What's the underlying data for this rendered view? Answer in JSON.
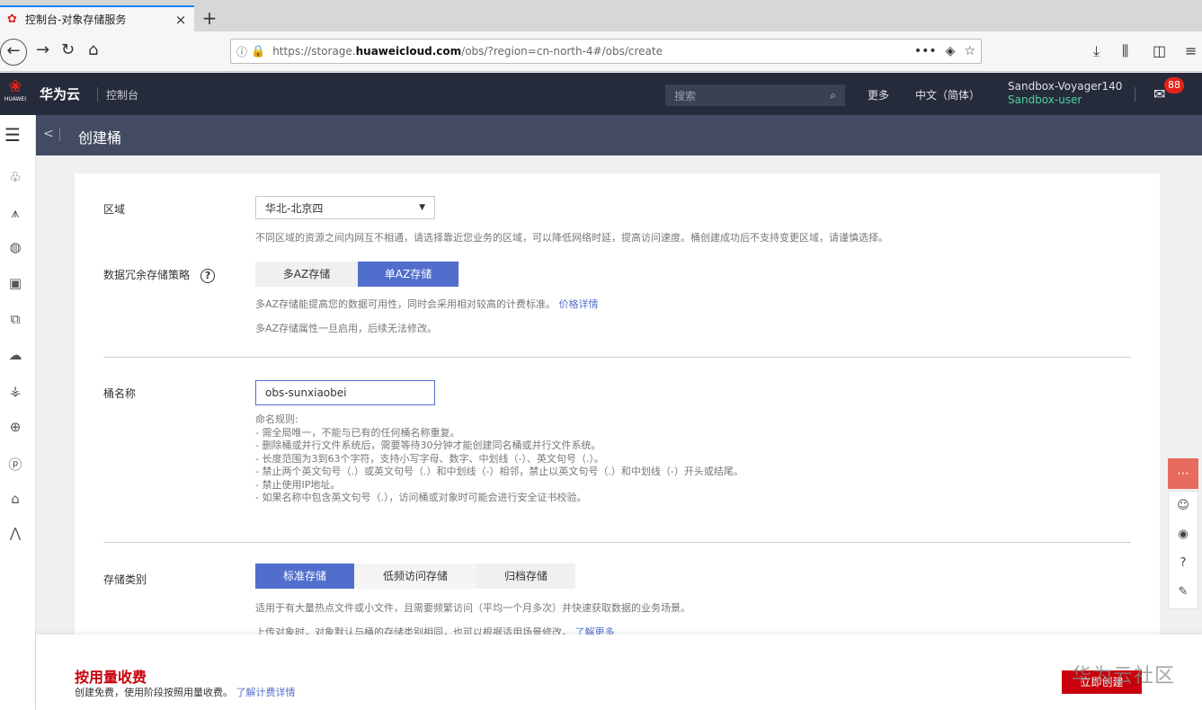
{
  "browser": {
    "tab_title": "控制台-对象存储服务",
    "tab_close": "×",
    "new_tab": "+",
    "url_prefix": "https://storage.",
    "url_domain": "huaweicloud.com",
    "url_suffix": "/obs/?region=cn-north-4#/obs/create",
    "url_more": "•••"
  },
  "header": {
    "logo_text": "HUAWEI",
    "brand": "华为云",
    "console": "控制台",
    "search_placeholder": "搜索",
    "more": "更多",
    "language": "中文（简体）",
    "account": "Sandbox-Voyager140",
    "sub_user": "Sandbox-user",
    "mail_badge": "88"
  },
  "subheader": {
    "back": "<",
    "title": "创建桶"
  },
  "form": {
    "region": {
      "label": "区域",
      "selected": "华北-北京四",
      "hint": "不同区域的资源之间内网互不相通，请选择靠近您业务的区域，可以降低网络时延，提高访问速度。桶创建成功后不支持变更区域，请谨慎选择。"
    },
    "redundancy": {
      "label": "数据冗余存储策略",
      "options": [
        "多AZ存储",
        "单AZ存储"
      ],
      "selected_index": 1,
      "hint1": "多AZ存储能提高您的数据可用性，同时会采用相对较高的计费标准。",
      "hint1_link": "价格详情",
      "hint2": "多AZ存储属性一旦启用，后续无法修改。"
    },
    "bucket_name": {
      "label": "桶名称",
      "value": "obs-sunxiaobei",
      "rules": [
        "命名规则:",
        "- 需全局唯一，不能与已有的任何桶名称重复。",
        "- 删除桶或并行文件系统后，需要等待30分钟才能创建同名桶或并行文件系统。",
        "- 长度范围为3到63个字符，支持小写字母、数字、中划线（-）、英文句号（.）。",
        "- 禁止两个英文句号（.）或英文句号（.）和中划线（-）相邻，禁止以英文句号（.）和中划线（-）开头或结尾。",
        "- 禁止使用IP地址。",
        "- 如果名称中包含英文句号（.），访问桶或对象时可能会进行安全证书校验。"
      ]
    },
    "storage_class": {
      "label": "存储类别",
      "options": [
        "标准存储",
        "低频访问存储",
        "归档存储"
      ],
      "selected_index": 0,
      "hint1": "适用于有大量热点文件或小文件，且需要频繁访问（平均一个月多次）并快速获取数据的业务场景。",
      "hint2": "上传对象时，对象默认与桶的存储类别相同，也可以根据适用场景修改。",
      "hint2_link": "了解更多"
    }
  },
  "footer": {
    "billing_title": "按用量收费",
    "billing_desc": "创建免费，使用阶段按照用量收费。",
    "billing_link": "了解计费详情",
    "create_button": "立即创建",
    "watermark": "华为云社区"
  },
  "colors": {
    "accent": "#526ecc",
    "brand_red": "#c7000b",
    "header_bg": "#252b3a",
    "subheader_bg": "#424b62"
  }
}
